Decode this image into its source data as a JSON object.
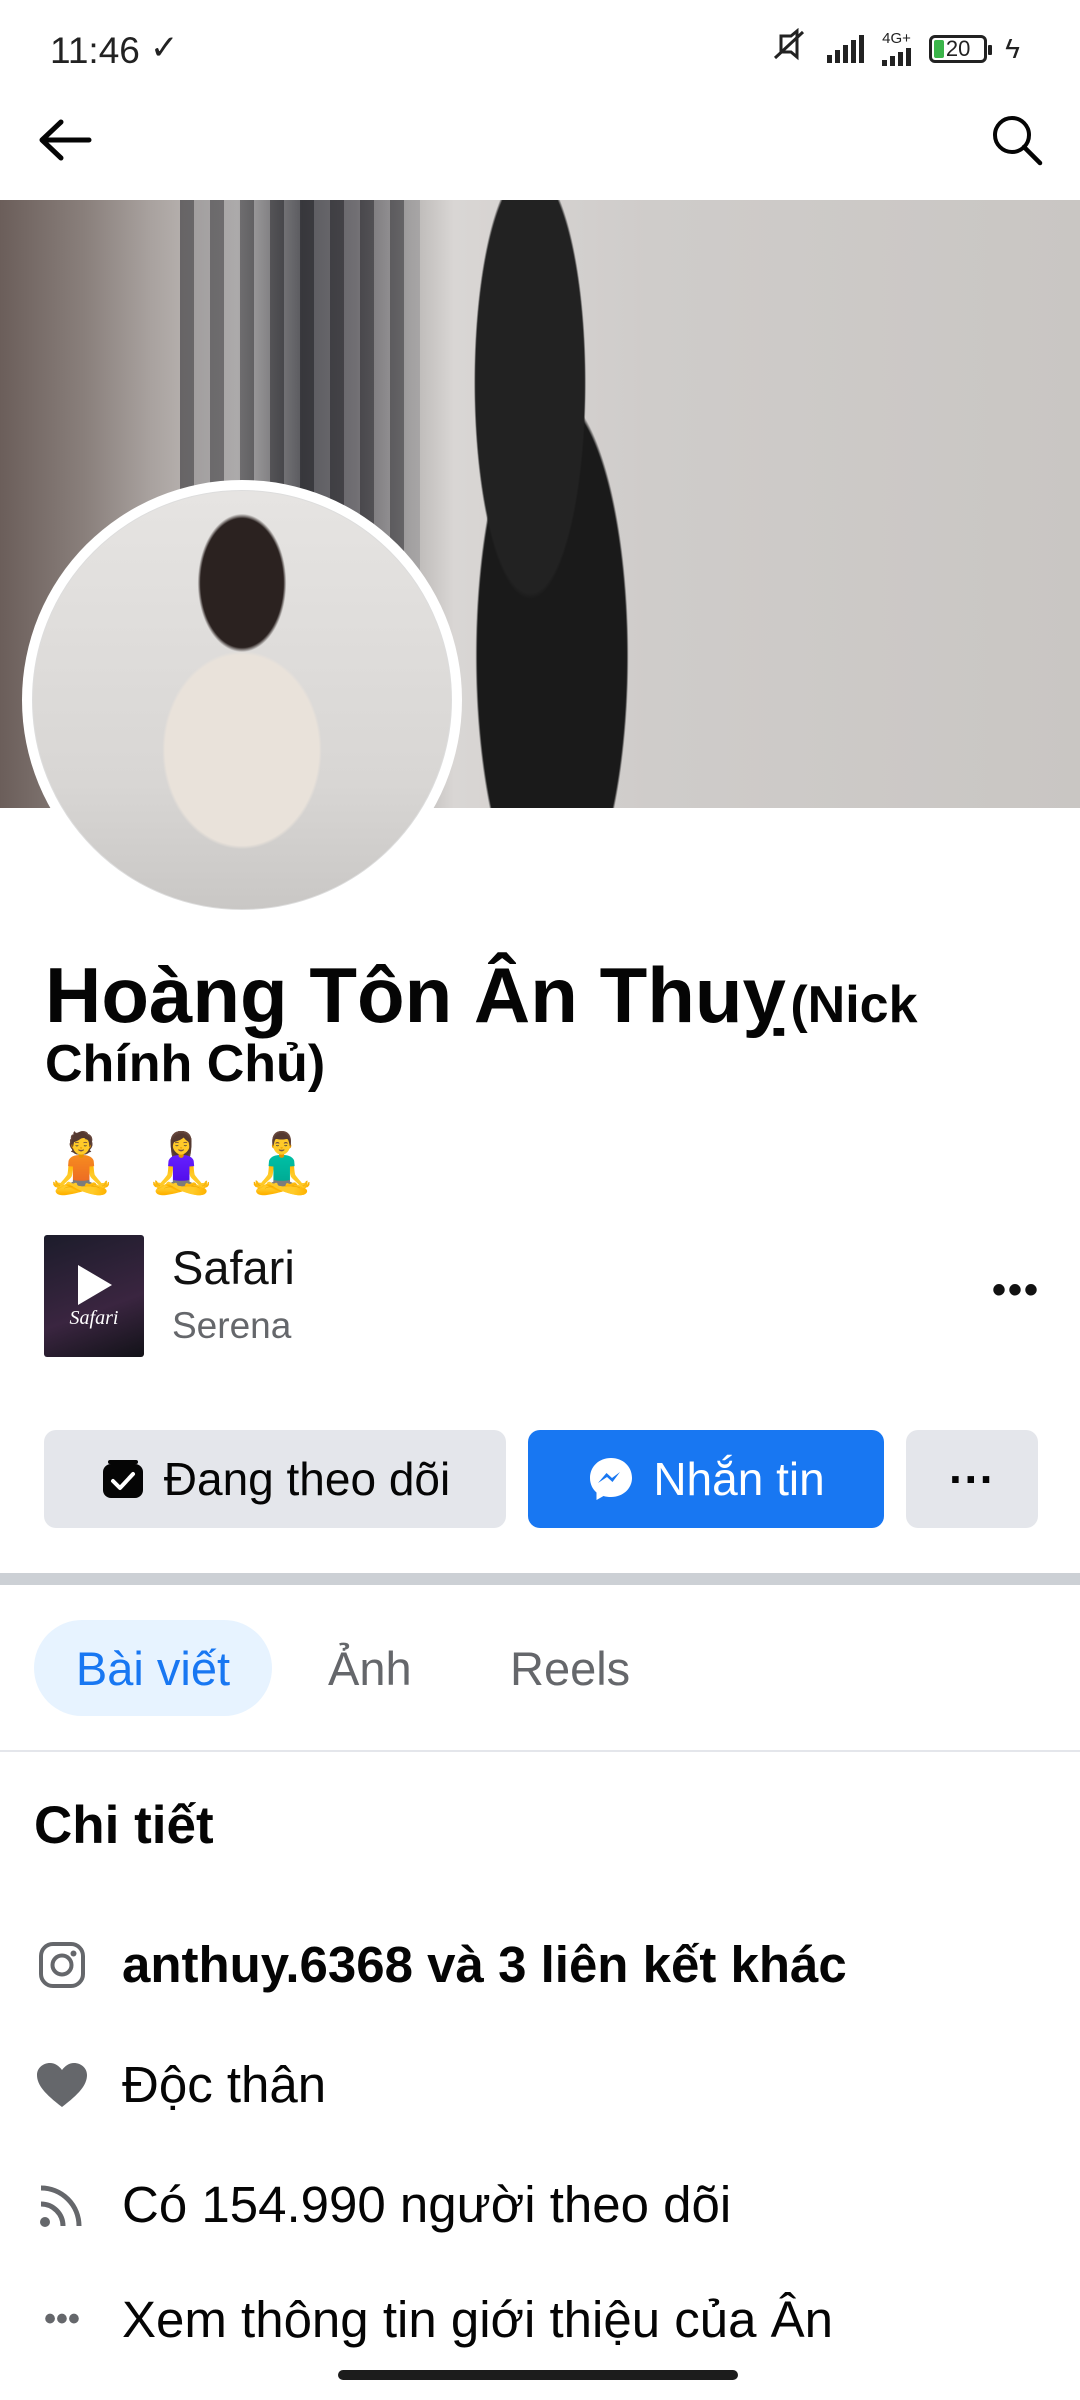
{
  "status_bar": {
    "time": "11:46",
    "network": "4G+",
    "battery": "20"
  },
  "profile": {
    "name": "Hoàng Tôn Ân Thuỵ",
    "name_suffix": "(Nick Chính Chủ)",
    "emojis": "🧘 🧘‍♀️ 🧘‍♂️"
  },
  "music": {
    "title": "Safari",
    "artist": "Serena",
    "art_text": "Safari"
  },
  "actions": {
    "follow_label": "Đang theo dõi",
    "message_label": "Nhắn tin",
    "more_label": "···"
  },
  "tabs": [
    {
      "label": "Bài viết",
      "active": true
    },
    {
      "label": "Ảnh",
      "active": false
    },
    {
      "label": "Reels",
      "active": false
    }
  ],
  "details": {
    "title": "Chi tiết",
    "instagram": "anthuy.6368 và 3 liên kết khác",
    "relationship": "Độc thân",
    "followers": "Có 154.990 người theo dõi",
    "about": "Xem thông tin giới thiệu của Ân"
  },
  "colors": {
    "brand_blue": "#1877f2",
    "button_gray": "#e4e6eb",
    "secondary_text": "#65676b",
    "tab_active_bg": "#e7f3ff"
  },
  "icons": {
    "back": "arrow-left-icon",
    "search": "search-icon",
    "follow": "followed-check-icon",
    "message": "messenger-icon",
    "instagram": "instagram-icon",
    "relationship": "heart-icon",
    "followers": "rss-icon",
    "about": "more-dots-icon"
  }
}
